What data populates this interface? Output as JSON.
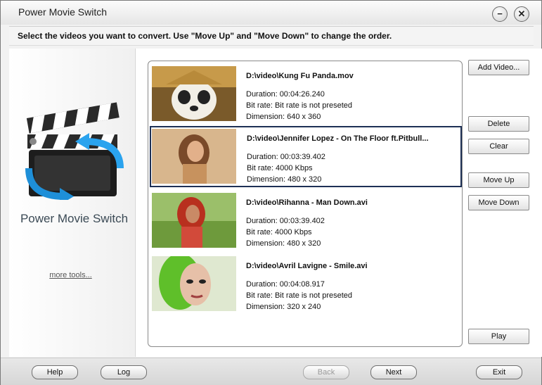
{
  "window": {
    "title": "Power Movie Switch"
  },
  "titlebar_buttons": {
    "minimize": "−",
    "close": "✕"
  },
  "instruction": "Select the videos you want to convert. Use \"Move Up\" and \"Move Down\" to change the order.",
  "left_panel": {
    "app_name": "Power Movie Switch",
    "more_tools": "more tools..."
  },
  "videos": [
    {
      "path": "D:\\video\\Kung Fu Panda.mov",
      "duration": "Duration: 00:04:26.240",
      "bitrate": "Bit rate: Bit rate is not preseted",
      "dimension": "Dimension: 640 x 360",
      "selected": false
    },
    {
      "path": "D:\\video\\Jennifer Lopez - On The Floor ft.Pitbull...",
      "duration": "Duration: 00:03:39.402",
      "bitrate": "Bit rate: 4000 Kbps",
      "dimension": "Dimension: 480 x 320",
      "selected": true
    },
    {
      "path": "D:\\video\\Rihanna - Man Down.avi",
      "duration": "Duration: 00:03:39.402",
      "bitrate": "Bit rate: 4000 Kbps",
      "dimension": "Dimension: 480 x 320",
      "selected": false
    },
    {
      "path": "D:\\video\\Avril Lavigne - Smile.avi",
      "duration": "Duration: 00:04:08.917",
      "bitrate": "Bit rate: Bit rate is not preseted",
      "dimension": "Dimension: 320 x 240",
      "selected": false
    }
  ],
  "side_buttons": {
    "add_video": "Add Video...",
    "delete": "Delete",
    "clear": "Clear",
    "move_up": "Move Up",
    "move_down": "Move Down",
    "play": "Play"
  },
  "footer": {
    "help": "Help",
    "log": "Log",
    "back": "Back",
    "next": "Next",
    "exit": "Exit"
  },
  "colors": {
    "selection_border": "#1e3055",
    "accent_arrow": "#1e8fd8"
  }
}
